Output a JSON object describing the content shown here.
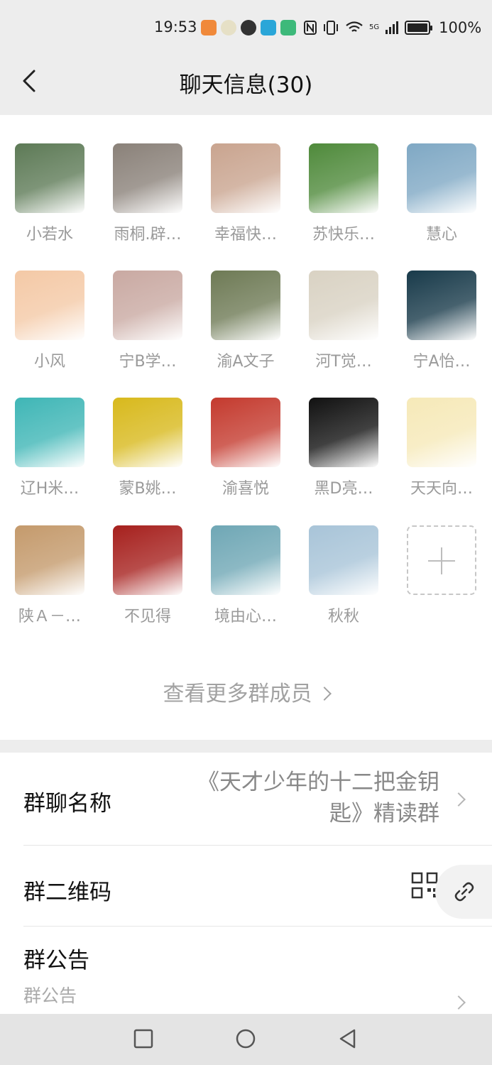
{
  "status_bar": {
    "time": "19:53",
    "network_label": "5G",
    "battery_level": 1.0,
    "battery_text": "100%"
  },
  "nav": {
    "title": "聊天信息(30)"
  },
  "members": [
    {
      "name": "小若水",
      "avatar_color": "#5d7a56"
    },
    {
      "name": "雨桐.辟…",
      "avatar_color": "#8a8179"
    },
    {
      "name": "幸福快…",
      "avatar_color": "#c9a48f"
    },
    {
      "name": "苏快乐…",
      "avatar_color": "#4f8a3b"
    },
    {
      "name": "慧心",
      "avatar_color": "#7fa8c4"
    },
    {
      "name": "小风",
      "avatar_color": "#f4c9a6"
    },
    {
      "name": "宁B学…",
      "avatar_color": "#c9a9a2"
    },
    {
      "name": "渝A文子",
      "avatar_color": "#6e7a55"
    },
    {
      "name": "河T觉…",
      "avatar_color": "#d9d2c3"
    },
    {
      "name": "宁A怡…",
      "avatar_color": "#183a4a"
    },
    {
      "name": "辽H米…",
      "avatar_color": "#3fb6b6"
    },
    {
      "name": "蒙B姚…",
      "avatar_color": "#d8b91c"
    },
    {
      "name": "渝喜悦",
      "avatar_color": "#c43a2e"
    },
    {
      "name": "黑D亮…",
      "avatar_color": "#111111"
    },
    {
      "name": "天天向…",
      "avatar_color": "#f6e9b8"
    },
    {
      "name": "陕Ａ－…",
      "avatar_color": "#c49a6c"
    },
    {
      "name": "不见得",
      "avatar_color": "#a6201d"
    },
    {
      "name": "境由心…",
      "avatar_color": "#6fa7b5"
    },
    {
      "name": "秋秋",
      "avatar_color": "#a8c4d8"
    }
  ],
  "view_more": {
    "label": "查看更多群成员"
  },
  "settings": {
    "group_name": {
      "label": "群聊名称",
      "value_line1": "《天才少年的十二把金钥",
      "value_line2": "匙》精读群"
    },
    "qr_code": {
      "label": "群二维码"
    },
    "announcement": {
      "label": "群公告",
      "placeholder": "群公告"
    }
  }
}
